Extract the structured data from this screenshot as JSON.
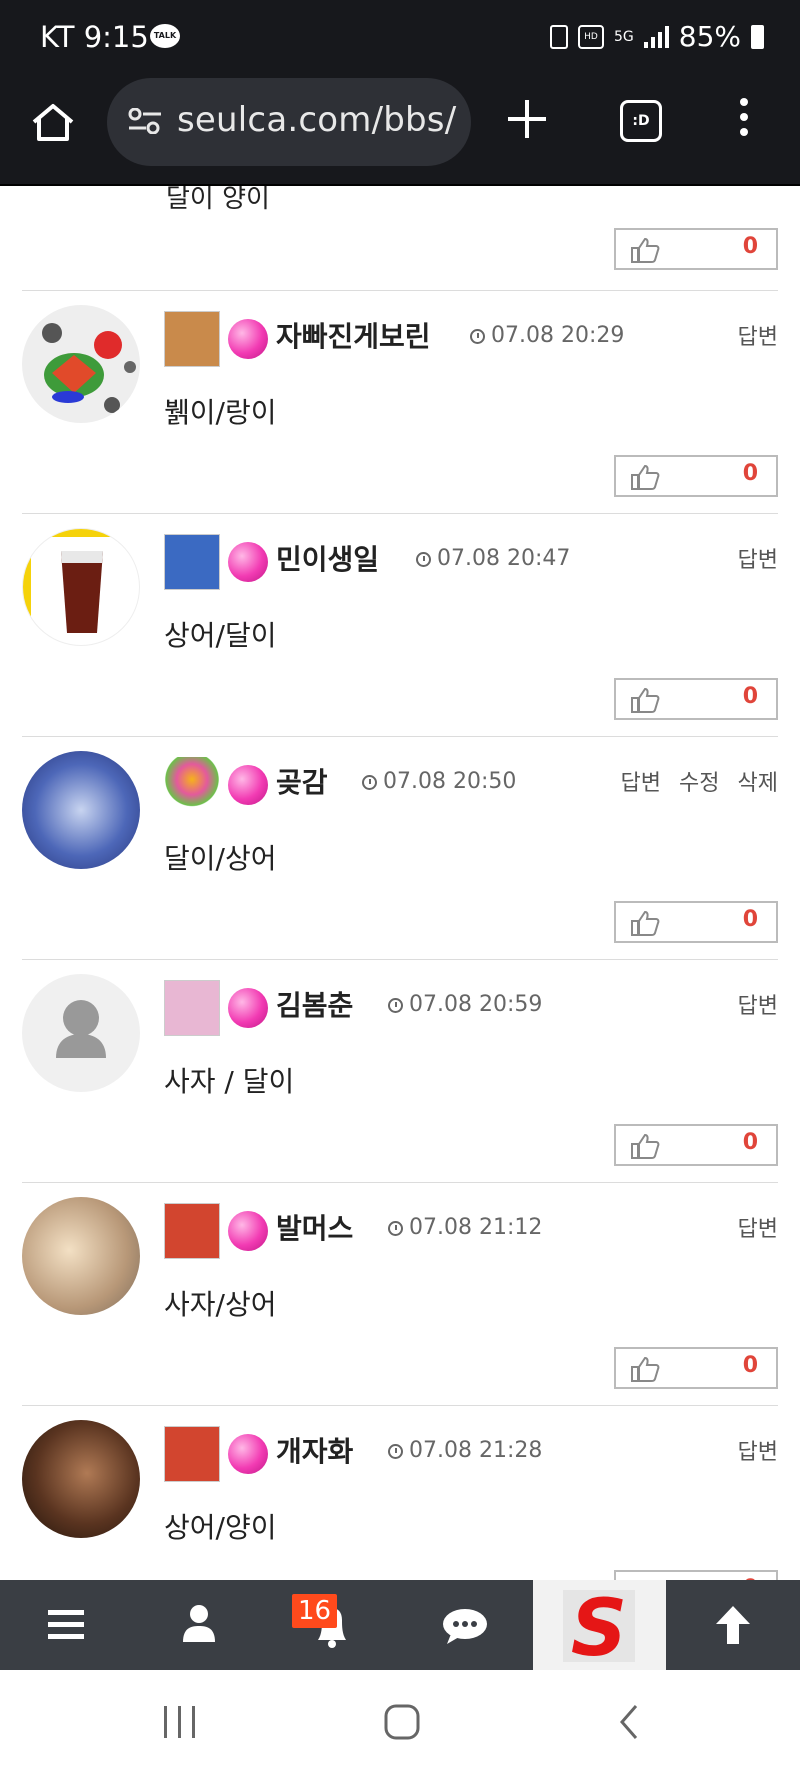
{
  "status_bar": {
    "carrier_time": "KT 9:15",
    "talk_label": "TALK",
    "hd_label": "HD",
    "network": "5G",
    "battery": "85%"
  },
  "browser": {
    "url": "seulca.com/bbs/",
    "tabs_label": ":D"
  },
  "top_partial": {
    "text": "달이 양이"
  },
  "comments": [
    {
      "nickname": "자빠진게보린",
      "time": "07.08 20:29",
      "actions": [
        "답변"
      ],
      "text": "뷁이/랑이",
      "likes": "0",
      "badge_color": "#c98a4b",
      "avatar_color": "#ffffff"
    },
    {
      "nickname": "민이생일",
      "time": "07.08 20:47",
      "actions": [
        "답변"
      ],
      "text": "상어/달이",
      "likes": "0",
      "badge_color": "#3b6ac2",
      "avatar_color": "#ffffff"
    },
    {
      "nickname": "곶감",
      "time": "07.08 20:50",
      "actions": [
        "답변",
        "수정",
        "삭제"
      ],
      "text": "달이/상어",
      "likes": "0",
      "badge_color": "#ffffff",
      "avatar_color": "#3a54b0"
    },
    {
      "nickname": "김봄춘",
      "time": "07.08 20:59",
      "actions": [
        "답변"
      ],
      "text": "사자 / 달이",
      "likes": "0",
      "badge_color": "#e8b7d3",
      "avatar_color": "#ededed"
    },
    {
      "nickname": "발머스",
      "time": "07.08 21:12",
      "actions": [
        "답변"
      ],
      "text": "사자/상어",
      "likes": "0",
      "badge_color": "#d2452f",
      "avatar_color": "#c9b8a4"
    },
    {
      "nickname": "개자화",
      "time": "07.08 21:28",
      "actions": [
        "답변"
      ],
      "text": "상어/양이",
      "likes": "0",
      "badge_color": "#d2452f",
      "avatar_color": "#3b2418"
    }
  ],
  "bottom_nav": {
    "notification_count": "16",
    "logo_letter": "S"
  }
}
